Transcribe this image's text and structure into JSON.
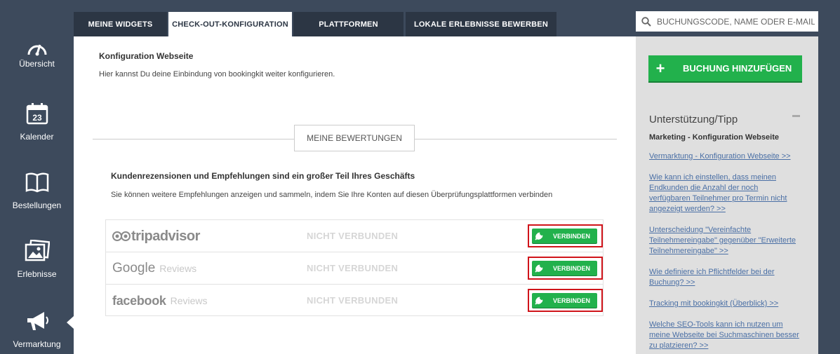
{
  "sidebar": {
    "items": [
      {
        "label": "Übersicht",
        "icon": "gauge-icon"
      },
      {
        "label": "Kalender",
        "icon": "calendar-icon",
        "day": "23"
      },
      {
        "label": "Bestellungen",
        "icon": "book-icon"
      },
      {
        "label": "Erlebnisse",
        "icon": "pictures-icon"
      },
      {
        "label": "Vermarktung",
        "icon": "megaphone-icon"
      }
    ]
  },
  "tabs": [
    {
      "label": "MEINE WIDGETS"
    },
    {
      "label": "CHECK-OUT-KONFIGURATION"
    },
    {
      "label": "PLATTFORMEN"
    },
    {
      "label": "LOKALE ERLEBNISSE BEWERBEN"
    }
  ],
  "search": {
    "placeholder": "BUCHUNGSCODE, NAME ODER E-MAIL"
  },
  "main": {
    "title": "Konfiguration Webseite",
    "description": "Hier kannst Du deine Einbindung von bookingkit weiter konfigurieren.",
    "divider_label": "MEINE BEWERTUNGEN",
    "reviews_title": "Kundenrezensionen und Empfehlungen sind ein großer Teil Ihres Geschäfts",
    "reviews_description": "Sie können weitere Empfehlungen anzeigen und sammeln, indem Sie Ihre Konten auf diesen Überprüfungsplattformen verbinden",
    "platforms": [
      {
        "name": "tripadvisor",
        "suffix": "",
        "status": "NICHT VERBUNDEN",
        "button": "VERBINDEN"
      },
      {
        "name": "Google",
        "suffix": "Reviews",
        "status": "NICHT VERBUNDEN",
        "button": "VERBINDEN"
      },
      {
        "name": "facebook",
        "suffix": "Reviews",
        "status": "NICHT VERBUNDEN",
        "button": "VERBINDEN"
      }
    ]
  },
  "right": {
    "add_booking": "BUCHUNG HINZUFÜGEN",
    "support_title": "Unterstützung/Tipp",
    "support_subtitle": "Marketing - Konfiguration Webseite",
    "links": [
      "Vermarktung - Konfiguration Webseite >>",
      "Wie kann ich einstellen, dass meinen Endkunden die Anzahl der noch verfügbaren Teilnehmer pro Termin nicht angezeigt werden? >>",
      "Unterscheidung \"Vereinfachte Teilnehmereingabe\" gegenüber \"Erweiterte Teilnehmereingabe\" >>",
      "Wie definiere ich Pflichtfelder bei der Buchung? >>",
      "Tracking mit bookingkit (Überblick) >>",
      "Welche SEO-Tools kann ich nutzen um meine Webseite bei Suchmaschinen besser zu platzieren? >>"
    ]
  },
  "colors": {
    "sidebar": "#3d4a5c",
    "tab_dark": "#2c3644",
    "green": "#22b14c",
    "highlight": "#d0141a"
  }
}
